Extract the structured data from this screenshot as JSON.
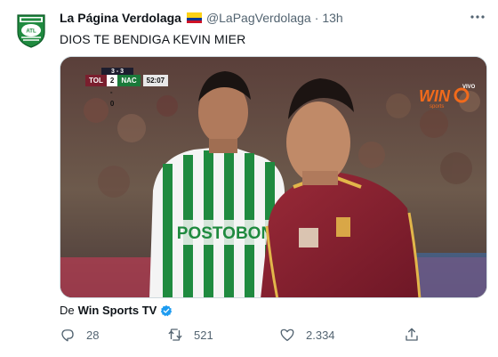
{
  "author": {
    "name": "La Página Verdolaga",
    "handle": "@LaPagVerdolaga",
    "separator": "·",
    "time": "13h",
    "avatar_icon": "verdolaga-crest-icon",
    "flag_icon": "colombia-flag-icon"
  },
  "tweet": {
    "text": "DIOS TE BENDIGA KEVIN MIER"
  },
  "media": {
    "scorebug": {
      "aggregate": "3 - 3",
      "team_home": "TOL",
      "score": "2 - 0",
      "team_away": "NAC",
      "clock": "52:07"
    },
    "broadcaster_logo": "WIN",
    "broadcaster_logo_small": "sports",
    "shirt_sponsor": "POSTOBON",
    "broadcaster_tag": "VIVO"
  },
  "source": {
    "prefix": "De",
    "name": "Win Sports TV",
    "verified_icon": "verified-badge-icon"
  },
  "actions": {
    "replies": "28",
    "retweets": "521",
    "likes": "2.334"
  },
  "colors": {
    "accent": "#1d9bf0",
    "text_primary": "#0f1419",
    "text_secondary": "#536471",
    "verdolaga_green": "#1f8a3f"
  }
}
